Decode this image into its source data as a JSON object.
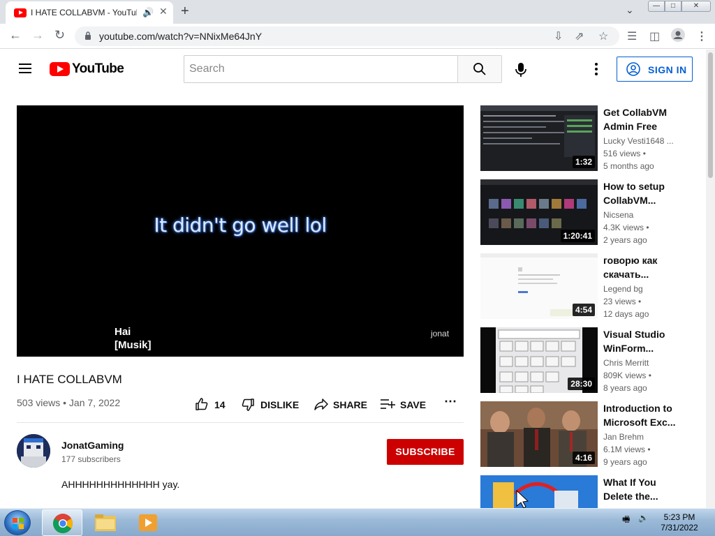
{
  "browser": {
    "tab_title": "I HATE COLLABVM - YouTube",
    "url": "youtube.com/watch?v=NNixMe64JnY",
    "accent": "#dee1e6"
  },
  "header": {
    "logo_text": "YouTube",
    "search_placeholder": "Search",
    "sign_in_label": "SIGN IN"
  },
  "player": {
    "overlay_text": "It didn't go well lol",
    "caption_line1": "Hai",
    "caption_line2": "[Musik]",
    "watermark": "jonat"
  },
  "video": {
    "title": "I HATE COLLABVM",
    "views_date": "503 views • Jan 7, 2022",
    "likes": "14",
    "dislike_label": "DISLIKE",
    "share_label": "SHARE",
    "save_label": "SAVE"
  },
  "channel": {
    "name": "JonatGaming",
    "subscribers": "177 subscribers",
    "subscribe_label": "SUBSCRIBE",
    "description": "AHHHHHHHHHHHHH yay."
  },
  "recommendations": [
    {
      "title": "Get CollabVM Admin Free",
      "channel": "Lucky Vesti1648 ...",
      "views": "516 views •",
      "age": "5 months ago",
      "duration": "1:32"
    },
    {
      "title": "How to setup CollabVM...",
      "channel": "Nicsena",
      "views": "4.3K views •",
      "age": "2 years ago",
      "duration": "1:20:41"
    },
    {
      "title": "говорю как скачать...",
      "channel": "Legend bg",
      "views": "23 views •",
      "age": "12 days ago",
      "duration": "4:54"
    },
    {
      "title": "Visual Studio WinForm...",
      "channel": "Chris Merritt",
      "views": "809K views •",
      "age": "8 years ago",
      "duration": "28:30"
    },
    {
      "title": "Introduction to Microsoft Exc...",
      "channel": "Jan Brehm",
      "views": "6.1M views •",
      "age": "9 years ago",
      "duration": "4:16"
    },
    {
      "title": "What If You Delete the...",
      "channel": "",
      "views": "",
      "age": "",
      "duration": ""
    }
  ],
  "taskbar": {
    "time": "5:23 PM",
    "date": "7/31/2022"
  }
}
